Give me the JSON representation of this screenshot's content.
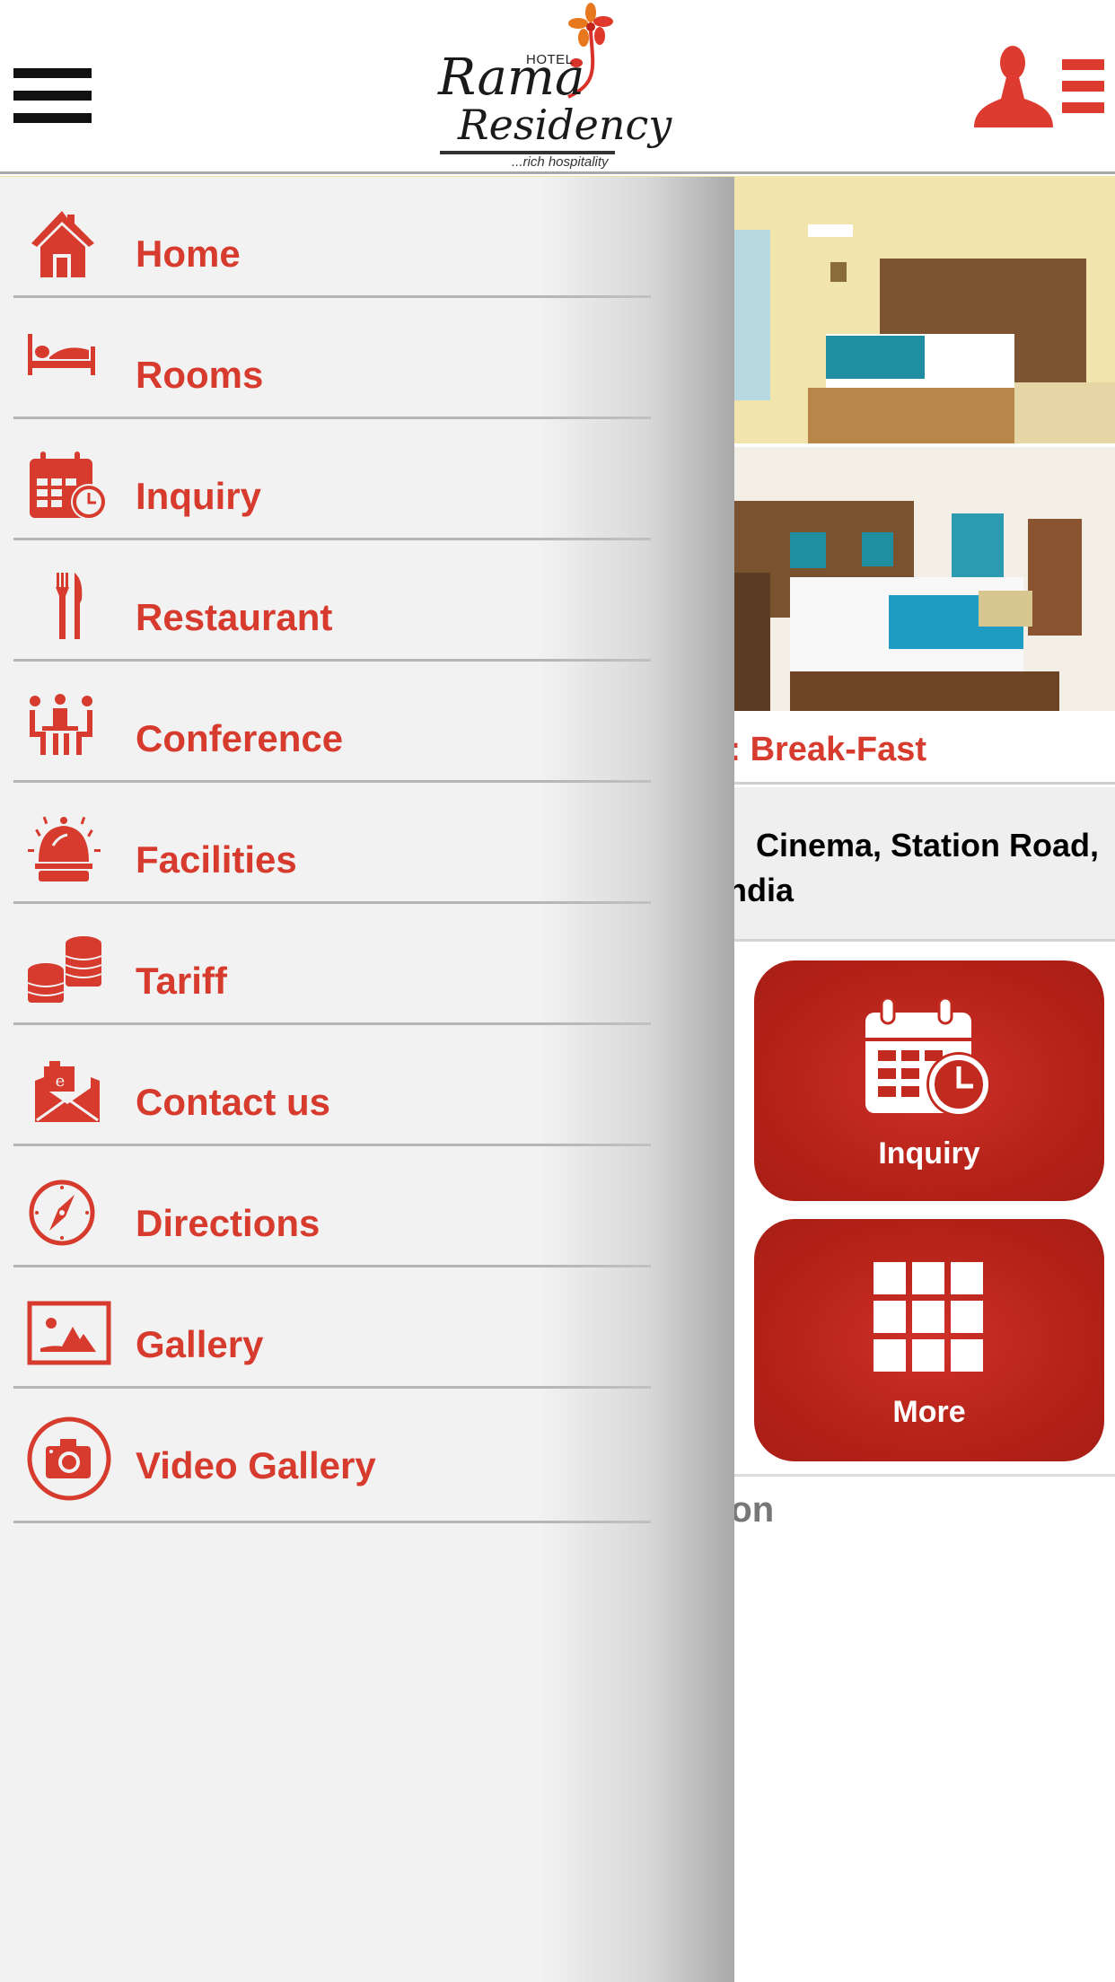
{
  "header": {
    "logo": {
      "hotel": "HOTEL",
      "name_line1": "Rama",
      "name_line2": "Residency",
      "tagline": "...rich hospitality"
    },
    "menu_icon": "hamburger-icon",
    "user_icon": "user-list-icon"
  },
  "theme": {
    "accent": "#d63b2e",
    "tile_red": "#b52218",
    "drawer_bg": "#f2f2f2"
  },
  "drawer": {
    "items": [
      {
        "label": "Home",
        "icon": "home-icon"
      },
      {
        "label": "Rooms",
        "icon": "bed-icon"
      },
      {
        "label": "Inquiry",
        "icon": "calendar-clock-icon"
      },
      {
        "label": "Restaurant",
        "icon": "fork-knife-icon"
      },
      {
        "label": "Conference",
        "icon": "conference-table-icon"
      },
      {
        "label": "Facilities",
        "icon": "service-bell-icon"
      },
      {
        "label": "Tariff",
        "icon": "coins-icon"
      },
      {
        "label": "Contact us",
        "icon": "envelope-icon"
      },
      {
        "label": "Directions",
        "icon": "compass-icon"
      },
      {
        "label": "Gallery",
        "icon": "image-icon"
      },
      {
        "label": "Video Gallery",
        "icon": "camera-icon"
      }
    ]
  },
  "page": {
    "breakfast_text": ": Break-Fast",
    "address_line1": "Cinema, Station Road,",
    "address_line2": "ndia",
    "tiles": [
      {
        "label": "Inquiry",
        "icon": "calendar-clock-icon"
      },
      {
        "label": "More",
        "icon": "grid-icon"
      }
    ],
    "follow_text": "s on"
  }
}
